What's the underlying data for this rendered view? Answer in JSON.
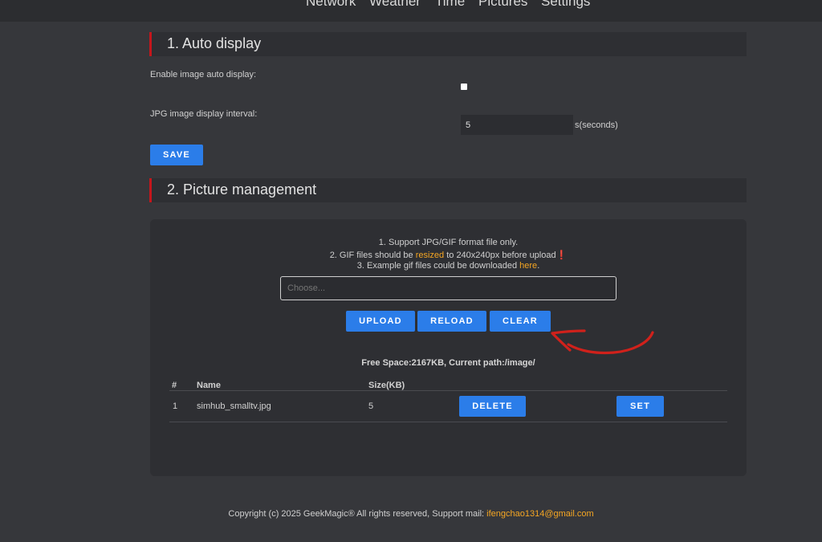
{
  "nav": {
    "items": [
      {
        "label": "Network"
      },
      {
        "label": "Weather"
      },
      {
        "label": "Time"
      },
      {
        "label": "Pictures"
      },
      {
        "label": "Settings"
      }
    ]
  },
  "auto_display": {
    "title": "1. Auto display",
    "enable_label": "Enable image auto display:",
    "enable_checked": false,
    "interval_label": "JPG image display interval:",
    "interval_value": "5",
    "interval_unit": "s(seconds)",
    "save_label": "SAVE"
  },
  "picture_management": {
    "title": "2. Picture management",
    "notes": {
      "line1": "1. Support JPG/GIF format file only.",
      "line2_prefix": "2. GIF files should be ",
      "line2_link": "resized",
      "line2_suffix": " to 240x240px before upload❗",
      "line3_prefix": "3. Example gif files could be downloaded ",
      "line3_link": "here",
      "line3_suffix": "."
    },
    "file_placeholder": "Choose...",
    "upload_label": "UPLOAD",
    "reload_label": "RELOAD",
    "clear_label": "CLEAR",
    "free_space": "Free Space:2167KB, Current path:/image/",
    "table": {
      "headers": [
        "#",
        "Name",
        "Size(KB)"
      ],
      "rows": [
        {
          "index": "1",
          "name": "simhub_smalltv.jpg",
          "size": "5",
          "delete_label": "DELETE",
          "set_label": "SET"
        }
      ]
    }
  },
  "footer": {
    "text": "Copyright (c) 2025 GeekMagic® All rights reserved, Support mail: ",
    "email": "ifengchao1314@gmail.com"
  },
  "colors": {
    "accent": "#2b7de9",
    "link": "#f5a623",
    "section_marker": "#c4161c",
    "annotation": "#d0211b"
  }
}
